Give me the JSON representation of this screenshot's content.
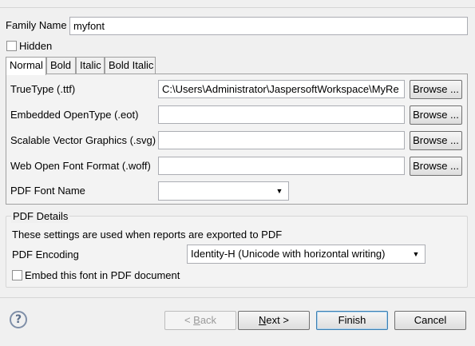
{
  "general": {
    "family_name_label": "Family Name",
    "family_name_value": "myfont",
    "hidden_label": "Hidden"
  },
  "tabs": [
    {
      "label": "Normal",
      "active": true
    },
    {
      "label": "Bold",
      "active": false
    },
    {
      "label": "Italic",
      "active": false
    },
    {
      "label": "Bold Italic",
      "active": false
    }
  ],
  "font_files": [
    {
      "label": "TrueType (.ttf)",
      "value": "C:\\Users\\Administrator\\JaspersoftWorkspace\\MyRe",
      "browse_label": "Browse ..."
    },
    {
      "label": "Embedded OpenType (.eot)",
      "value": "",
      "browse_label": "Browse ..."
    },
    {
      "label": "Scalable Vector Graphics (.svg)",
      "value": "",
      "browse_label": "Browse ..."
    },
    {
      "label": "Web Open Font Format (.woff)",
      "value": "",
      "browse_label": "Browse ..."
    }
  ],
  "pdf_font_name": {
    "label": "PDF Font Name",
    "value": ""
  },
  "pdf_details": {
    "title": "PDF Details",
    "description": "These settings are used when reports are exported to PDF",
    "encoding_label": "PDF Encoding",
    "encoding_value": "Identity-H (Unicode with horizontal writing)",
    "embed_label": "Embed this font in PDF document"
  },
  "footer": {
    "help_glyph": "?",
    "back_prefix": "< ",
    "back_mnemonic": "B",
    "back_rest": "ack",
    "next_mnemonic": "N",
    "next_rest": "ext >",
    "finish_label": "Finish",
    "cancel_label": "Cancel"
  },
  "colors": {
    "window_bg": "#f0f0f0",
    "default_button_border": "#3c7fb1"
  }
}
